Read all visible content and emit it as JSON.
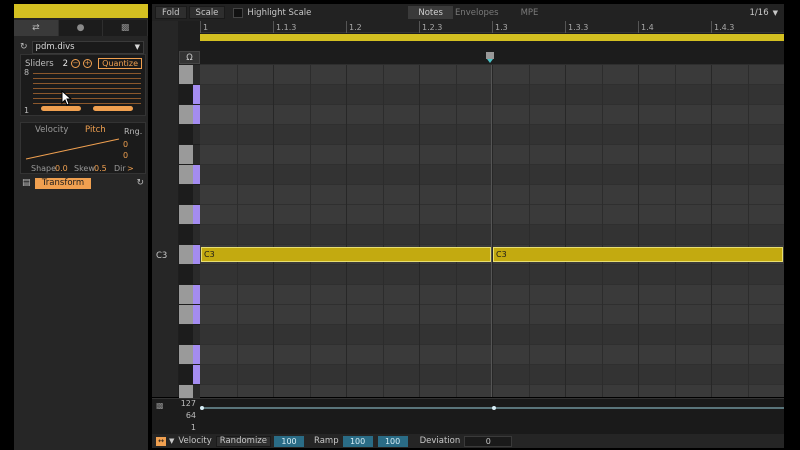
{
  "colors": {
    "clip": "#d4c021",
    "accent": "#f0a050",
    "note": "#c3aa10",
    "scale_key": "#a48cf0",
    "number_field": "#2a6c86"
  },
  "left_panel": {
    "tabs": [
      "sliders-icon",
      "palette-icon",
      "grid-icon"
    ],
    "device_name": "pdm.divs",
    "sliders": {
      "label": "Sliders",
      "count": "2",
      "quantize": "Quantize",
      "top_value": "8",
      "bottom_value": "1"
    },
    "transform": {
      "tab_velocity": "Velocity",
      "tab_pitch": "Pitch",
      "rng_label": "Rng.",
      "rng_top": "0",
      "rng_bottom": "0",
      "shape_label": "Shape",
      "shape_value": "0.0",
      "skew_label": "Skew",
      "skew_value": "0.5",
      "dir_label": "Dir",
      "dir_value": ">"
    },
    "transform_button": "Transform"
  },
  "toolbar": {
    "fold": "Fold",
    "scale": "Scale",
    "highlight_scale": "Highlight Scale",
    "tabs": [
      "Notes",
      "Envelopes",
      "MPE"
    ],
    "grid": "1/16"
  },
  "editor": {
    "pitch_label": "C3",
    "ruler": [
      "1",
      "1.1.3",
      "1.2",
      "1.2.3",
      "1.3",
      "1.3.3",
      "1.4",
      "1.4.3"
    ],
    "notes": [
      {
        "label": "C3",
        "start": 0,
        "length": 0.5
      },
      {
        "label": "C3",
        "start": 0.5,
        "length": 0.5
      }
    ]
  },
  "velocity_lane": {
    "max": "127",
    "mid": "64",
    "min": "1",
    "values": [
      127,
      127
    ]
  },
  "bottom_bar": {
    "velocity": "Velocity",
    "randomize": "Randomize",
    "randomize_value": "100",
    "ramp": "Ramp",
    "ramp_start": "100",
    "ramp_end": "100",
    "deviation": "Deviation",
    "deviation_value": "0"
  }
}
